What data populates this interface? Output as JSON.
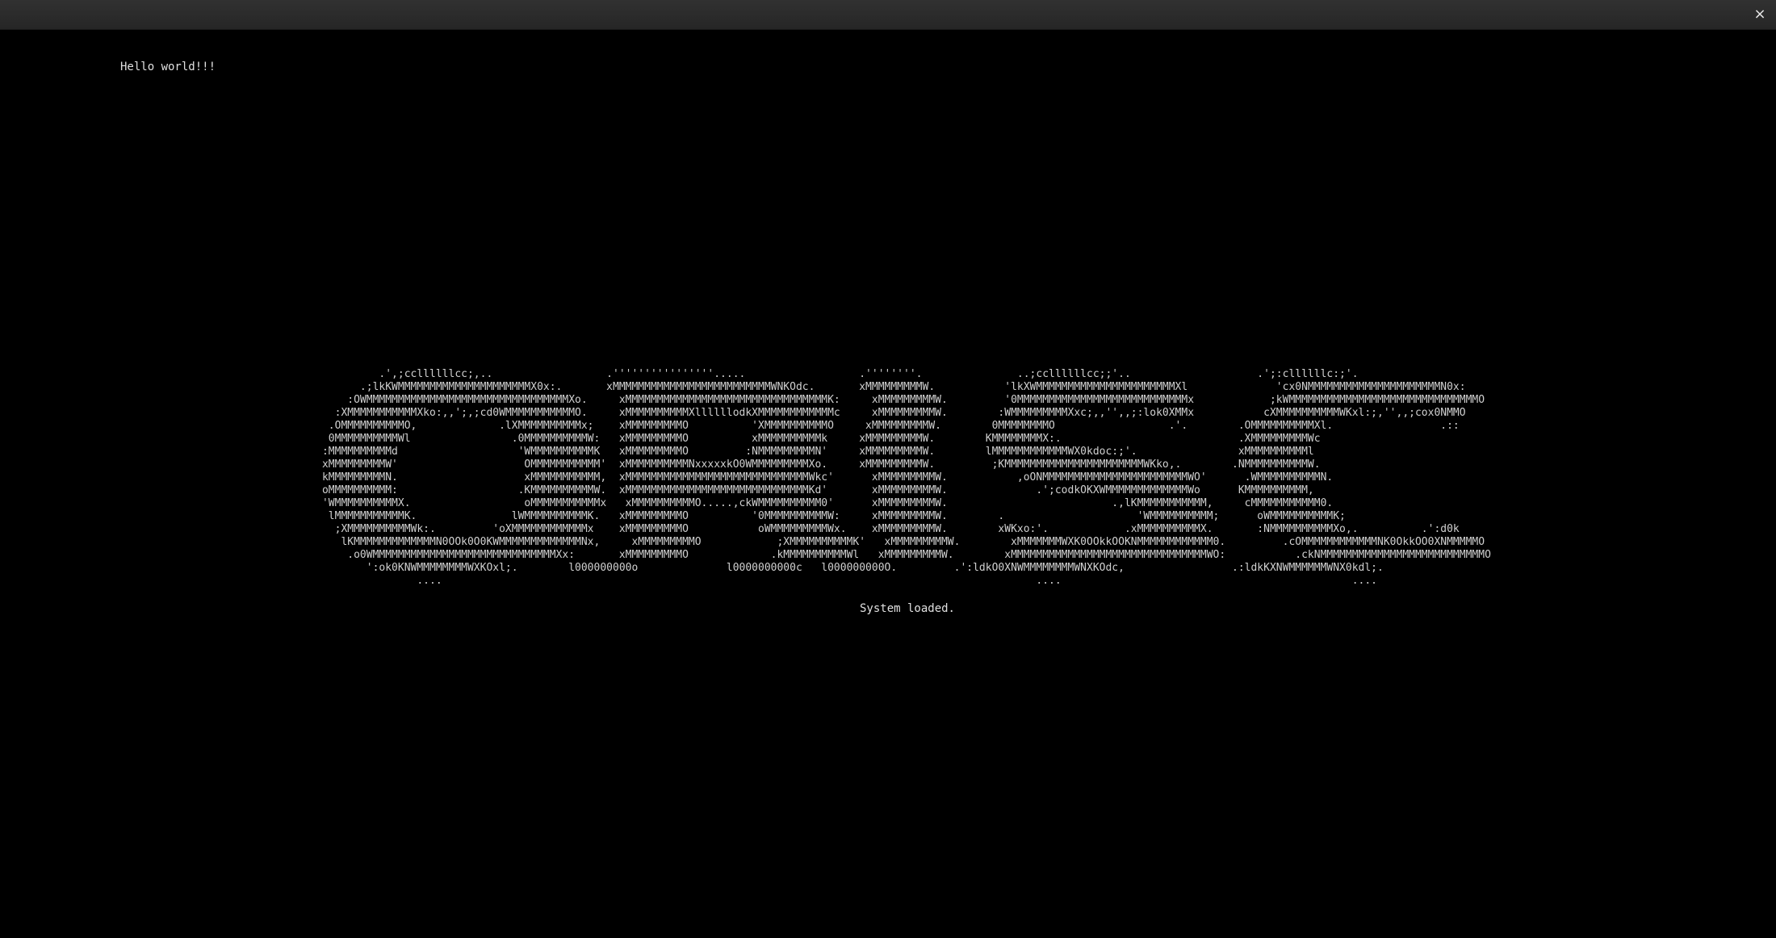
{
  "window": {
    "close_icon": "×"
  },
  "terminal": {
    "greeting": "Hello world!!!",
    "logo_lines": [
      "               .',;ccllllllcc;,..                  .''''''''''''''''.....                  .''''''''.               ..;ccllllllcc;;'..                    .';:cllllllc:;'.        ",
      "            .;lkKWMMMMMMMMMMMMMMMMMMMMMX0x:.       xMMMMMMMMMMMMMMMMMMMMMMMMMWNKOdc.       xMMMMMMMMMW.           'lkXWMMMMMMMMMMMMMMMMMMMMMMXl              'cx0NMMMMMMMMMMMMMMMMMMMMMN0x:",
      "          :OWMMMMMMMMMMMMMMMMMMMMMMMMMMMMMMMMXo.     xMMMMMMMMMMMMMMMMMMMMMMMMMMMMMMMMK:     xMMMMMMMMMW.         '0MMMMMMMMMMMMMMMMMMMMMMMMMMMx            ;kWMMMMMMMMMMMMMMMMMMMMMMMMMMMMMMO",
      "        :XMMMMMMMMMMMXko:,,';,;cd0WMMMMMMMMMMMO.     xMMMMMMMMMMXllllllodkXMMMMMMMMMMMMc     xMMMMMMMMMW.        :WMMMMMMMMMXxc;,,'',,;:lok0XMMx           cXMMMMMMMMMMWKxl:;,'',,;cox0NMMO",
      "       .OMMMMMMMMMMO,             .lXMMMMMMMMMMx;    xMMMMMMMMMO          'XMMMMMMMMMMO     xMMMMMMMMMW.        0MMMMMMMMO                  .'.        .OMMMMMMMMMMXl.                 .::",
      "       0MMMMMMMMMMWl                .0MMMMMMMMMMW:   xMMMMMMMMMO          xMMMMMMMMMMk     xMMMMMMMMMW.        KMMMMMMMMX:.                            .XMMMMMMMMMWc",
      "      :MMMMMMMMMMd                   'WMMMMMMMMMMK   xMMMMMMMMMO         :NMMMMMMMMMN'     xMMMMMMMMMW.        lMMMMMMMMMMMMWX0kdoc:;'.                xMMMMMMMMMMl",
      "      xMMMMMMMMMW'                    OMMMMMMMMMMM'  xMMMMMMMMMMNxxxxxkO0WMMMMMMMMMXo.     xMMMMMMMMMW.         ;KMMMMMMMMMMMMMMMMMMMMMMWKko,.        .NMMMMMMMMMMW.",
      "      kMMMMMMMMMN.                    xMMMMMMMMMMM,  xMMMMMMMMMMMMMMMMMMMMMMMMMMMMMWkc'      xMMMMMMMMMW.           ,oONMMMMMMMMMMMMMMMMMMMMMMMWO'      .WMMMMMMMMMMN.",
      "      oMMMMMMMMMM:                   .KMMMMMMMMMMW.  xMMMMMMMMMMMMMMMMMMMMMMMMMMMMMKd'       xMMMMMMMMMW.              .';codkOKXWMMMMMMMMMMMMMWo      KMMMMMMMMMM,",
      "      'WMMMMMMMMMMX.                  oMMMMMMMMMMMx   xMMMMMMMMMMO.....,ckWMMMMMMMMMM0'      xMMMMMMMMMW.                          .,lKMMMMMMMMMMM,     cMMMMMMMMMMM0.",
      "       lMMMMMMMMMMMK.               lWMMMMMMMMMMK.   xMMMMMMMMMO          '0MMMMMMMMMMW:     xMMMMMMMMMW.        .                     'WMMMMMMMMMM;      oWMMMMMMMMMMK;",
      "        ;XMMMMMMMMMMWk:.         'oXMMMMMMMMMMMMx    xMMMMMMMMMO           oWMMMMMMMMMWx.    xMMMMMMMMMW.        xWKxo:'.            .xMMMMMMMMMMX.       :NMMMMMMMMMMXo,.          .':d0k",
      "         lKMMMMMMMMMMMMMN0OOk0O0KWMMMMMMMMMMMMMNx,     xMMMMMMMMMO            ;XMMMMMMMMMMK'   xMMMMMMMMMW.        xMMMMMMMWXK0OOkkOOKNMMMMMMMMMMMM0.         .cOMMMMMMMMMMMMNK0OkkOO0XNMMMMMO",
      "          .o0WMMMMMMMMMMMMMMMMMMMMMMMMMMMMMXx:       xMMMMMMMMMO             .kMMMMMMMMMMWl   xMMMMMMMMMW.        xMMMMMMMMMMMMMMMMMMMMMMMMMMMMMMMWO:           .ckNMMMMMMMMMMMMMMMMMMMMMMMMMMO",
      "             ':ok0KNWMMMMMMMMWXKOxl;.        l000000000o              l0000000000c   l000000000O.         .':ldkO0XNWMMMMMMMMWNXKOdc,                 .:ldkKXNWMMMMMMWNX0kdl;.",
      "                     ....                                                                                              ....                                              ....  "
    ],
    "status": "System loaded."
  }
}
